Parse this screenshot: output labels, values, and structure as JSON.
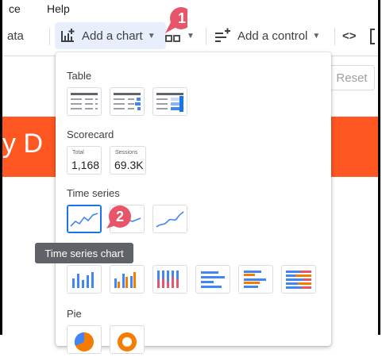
{
  "menubar": {
    "item_partial_left": "ce",
    "help": "Help"
  },
  "toolbar": {
    "data_partial": "ata",
    "add_chart": "Add a chart",
    "add_control": "Add a control",
    "code_icon": "<>"
  },
  "page": {
    "reset": "Reset",
    "band_text": "y D"
  },
  "menu": {
    "table": "Table",
    "scorecard": "Scorecard",
    "scorecards": [
      {
        "label": "Total",
        "value": "1,168"
      },
      {
        "label": "Sessions",
        "value": "69.3K"
      }
    ],
    "time_series": "Time series",
    "pie": "Pie"
  },
  "tooltip": "Time series chart",
  "callouts": [
    "1",
    "2"
  ],
  "colors": {
    "accent": "#1a73e8",
    "callout": "#e8556b",
    "band": "#ff5722",
    "orange": "#f57c00"
  }
}
